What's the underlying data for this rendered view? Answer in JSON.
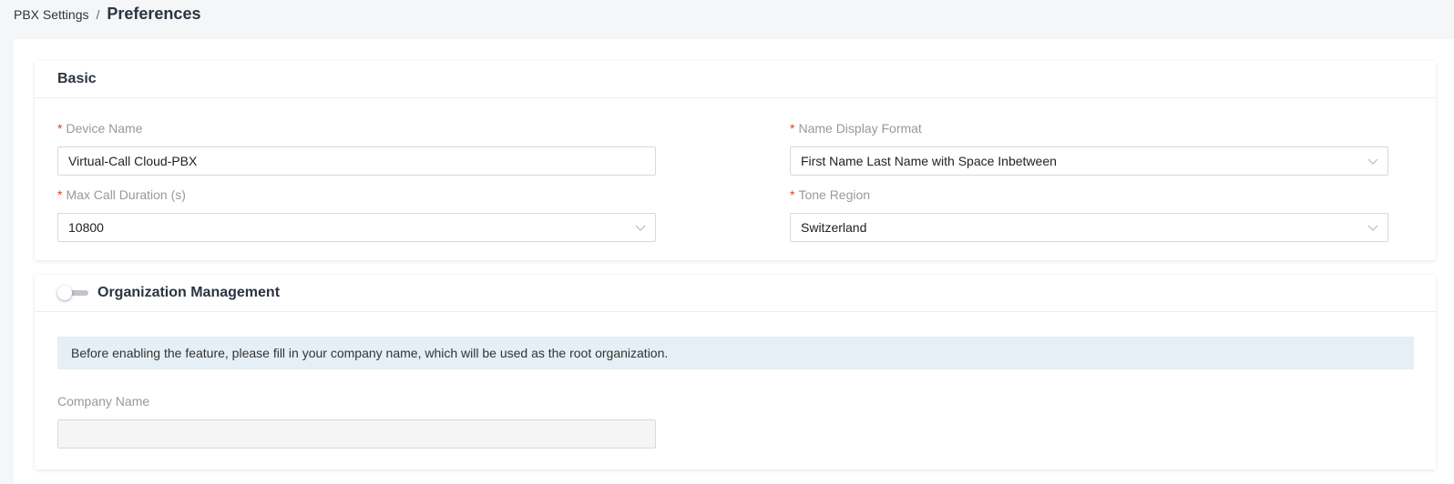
{
  "breadcrumb": {
    "parent": "PBX Settings",
    "separator": "/",
    "current": "Preferences"
  },
  "basic": {
    "title": "Basic",
    "device_name": {
      "label": "Device Name",
      "value": "Virtual-Call Cloud-PBX"
    },
    "name_display_format": {
      "label": "Name Display Format",
      "value": "First Name Last Name with Space Inbetween"
    },
    "max_call_duration": {
      "label": "Max Call Duration (s)",
      "value": "10800"
    },
    "tone_region": {
      "label": "Tone Region",
      "value": "Switzerland"
    }
  },
  "organization": {
    "title": "Organization Management",
    "enabled": false,
    "notice": "Before enabling the feature, please fill in your company name, which will be used as the root organization.",
    "company_name": {
      "label": "Company Name",
      "value": ""
    }
  },
  "required_marker": "*",
  "icons": {
    "dropdown": "chevron-down-icon"
  },
  "colors": {
    "required": "#e0412e",
    "notice_bg": "#e6eff6",
    "page_bg": "#f4f6f8"
  }
}
